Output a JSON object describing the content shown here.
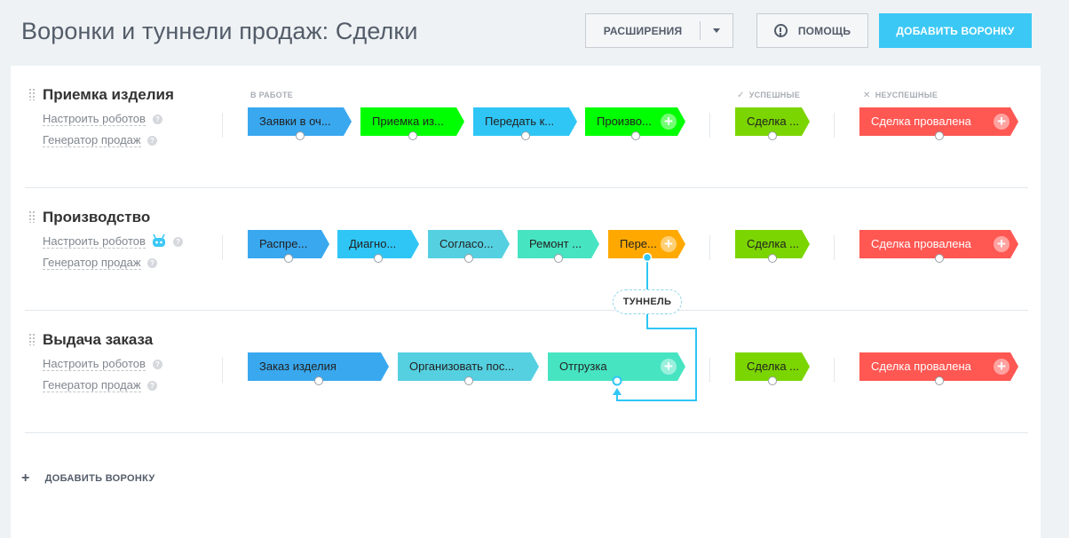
{
  "header": {
    "title": "Воронки и туннели продаж: Сделки",
    "extensions_label": "Расширения",
    "help_label": "Помощь",
    "add_funnel_label": "Добавить воронку"
  },
  "columns": {
    "in_work": "в работе",
    "success": "успешные",
    "fail": "неуспешные"
  },
  "funnel_links": {
    "robots": "Настроить роботов",
    "generator": "Генератор продаж"
  },
  "funnels": [
    {
      "name": "Приемка изделия",
      "stages": [
        {
          "label": "Заявки в оч...",
          "color": "#39a8ef"
        },
        {
          "label": "Приемка из...",
          "color": "#00ff00"
        },
        {
          "label": "Передать к...",
          "color": "#2fc6f6"
        },
        {
          "label": "Произво...",
          "color": "#00ff00"
        }
      ],
      "success": "Сделка ...",
      "fail": "Сделка провалена"
    },
    {
      "name": "Производство",
      "stages": [
        {
          "label": "Распре...",
          "color": "#39a8ef"
        },
        {
          "label": "Диагно...",
          "color": "#2fc6f6"
        },
        {
          "label": "Согласо...",
          "color": "#55d0e0"
        },
        {
          "label": "Ремонт ...",
          "color": "#47e4c2"
        },
        {
          "label": "Пере...",
          "color": "#ffa900"
        }
      ],
      "success": "Сделка ...",
      "fail": "Сделка провалена"
    },
    {
      "name": "Выдача заказа",
      "stages": [
        {
          "label": "Заказ изделия",
          "color": "#39a8ef"
        },
        {
          "label": "Организовать пос...",
          "color": "#55d0e0"
        },
        {
          "label": "Отгрузка",
          "color": "#47e4c2"
        }
      ],
      "success": "Сделка ...",
      "fail": "Сделка провалена"
    }
  ],
  "tunnel_label": "туннель",
  "add_funnel_bottom": "Добавить воронку",
  "colors": {
    "success": "#7bd500",
    "fail": "#ff5752",
    "accent": "#3bc8f5",
    "tunnel": "#2fc6f6"
  }
}
